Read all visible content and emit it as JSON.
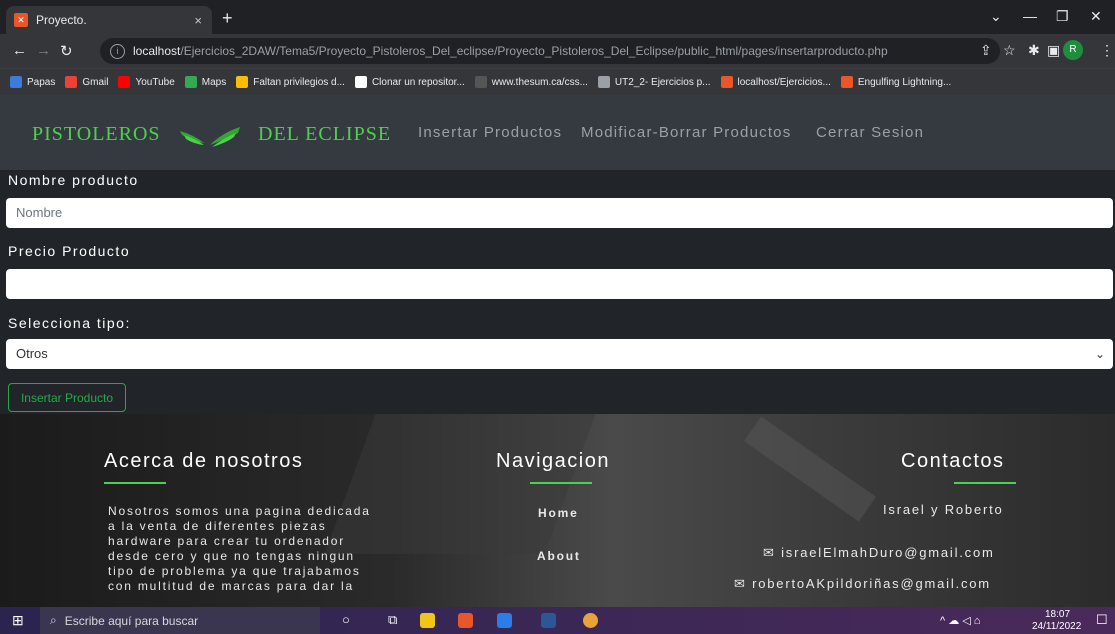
{
  "browser": {
    "tab_title": "Proyecto.",
    "tab_close": "×",
    "new_tab": "+",
    "url_host": "localhost",
    "url_path": "/Ejercicios_2DAW/Tema5/Proyecto_Pistoleros_Del_eclipse/Proyecto_Pistoleros_Del_Eclipse/public_html/pages/insertarproducto.php",
    "profile_initial": "R"
  },
  "bookmarks": [
    {
      "label": "Papas",
      "color": "#3b7bd9"
    },
    {
      "label": "Gmail",
      "color": "#ea4335"
    },
    {
      "label": "YouTube",
      "color": "#ff0000"
    },
    {
      "label": "Maps",
      "color": "#34a853"
    },
    {
      "label": "Faltan privilegios d...",
      "color": "#fbbc04"
    },
    {
      "label": "Clonar un repositor...",
      "color": "#ffffff"
    },
    {
      "label": "www.thesum.ca/css...",
      "color": "#555555"
    },
    {
      "label": "UT2_2- Ejercicios p...",
      "color": "#9aa0a6"
    },
    {
      "label": "localhost/Ejercicios...",
      "color": "#e8562a"
    },
    {
      "label": "Engulfing Lightning...",
      "color": "#e8562a"
    }
  ],
  "header": {
    "logo_left": "PISTOLEROS",
    "logo_right": "DEL ECLIPSE",
    "nav": [
      "Insertar Productos",
      "Modificar-Borrar Productos",
      "Cerrar Sesion"
    ]
  },
  "form": {
    "name_label": "Nombre producto",
    "name_placeholder": "Nombre",
    "price_label": "Precio Producto",
    "price_value": "",
    "type_label": "Selecciona tipo:",
    "type_selected": "Otros",
    "submit_label": "Insertar Producto"
  },
  "footer": {
    "about_title": "Acerca de nosotros",
    "about_lines": [
      "Nosotros somos una pagina dedicada",
      "a la venta de diferentes piezas",
      "hardware para crear tu ordenador",
      "desde cero y que no tengas ningun",
      "tipo de problema ya que trajabamos",
      "con multitud de marcas para dar la"
    ],
    "nav_title": "Navigacion",
    "nav_links": [
      "Home",
      "About"
    ],
    "contact_title": "Contactos",
    "contact_names": "Israel y Roberto",
    "contact_emails": [
      "israelElmahDuro@gmail.com",
      "robertoAKpildoriñas@gmail.com"
    ]
  },
  "taskbar": {
    "search_placeholder": "Escribe aquí para buscar",
    "time": "18:07",
    "date": "24/11/2022"
  },
  "colors": {
    "accent": "#4cd14c",
    "button": "#28a745"
  }
}
